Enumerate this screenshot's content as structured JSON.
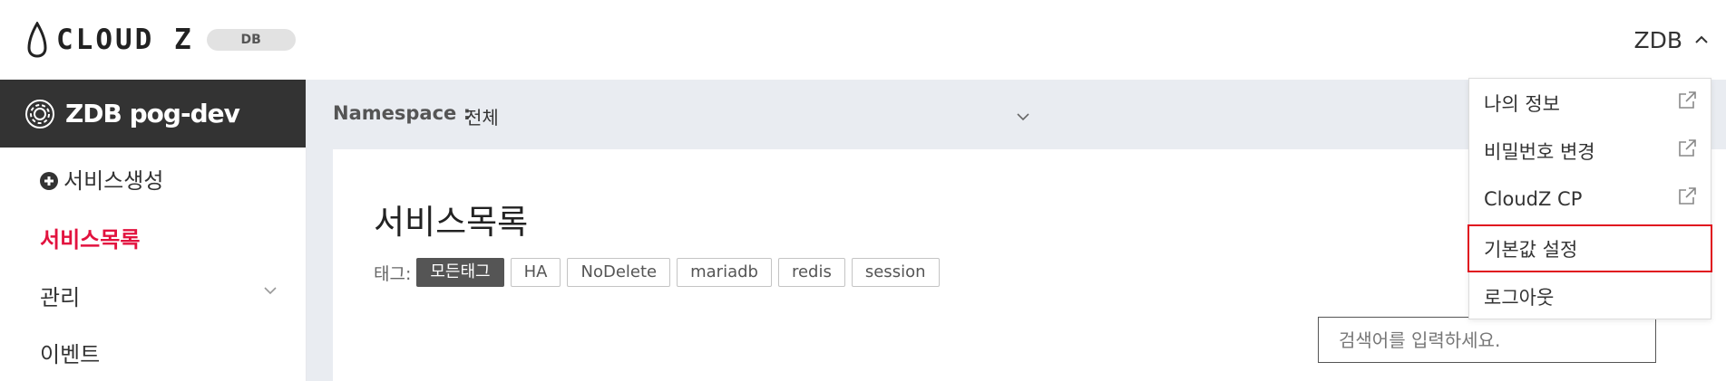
{
  "header": {
    "logo_text": "CLOUD Z",
    "badge": "DB",
    "user_name": "ZDB"
  },
  "sidebar": {
    "cluster_name": "ZDB pog-dev",
    "items": [
      {
        "label": "서비스생성"
      },
      {
        "label": "서비스목록"
      },
      {
        "label": "관리"
      },
      {
        "label": "이벤트"
      }
    ]
  },
  "filter": {
    "namespace_label": "Namespace :",
    "namespace_value": "전체"
  },
  "main": {
    "title": "서비스목록",
    "tags_label": "태그:",
    "tags": [
      "모든태그",
      "HA",
      "NoDelete",
      "mariadb",
      "redis",
      "session"
    ],
    "selected_tag": "모든태그",
    "search_placeholder": "검색어를 입력하세요."
  },
  "user_dropdown": {
    "items": [
      {
        "label": "나의 정보",
        "icon": "external-link-icon"
      },
      {
        "label": "비밀번호 변경",
        "icon": "external-link-icon"
      },
      {
        "label": "CloudZ CP",
        "icon": "external-link-icon"
      },
      {
        "label": "기본값 설정"
      },
      {
        "label": "로그아웃"
      }
    ],
    "highlighted": "기본값 설정"
  },
  "colors": {
    "sidebar_header_bg": "#333333",
    "active_nav": "#e2123e",
    "highlight_border": "#e0101e",
    "main_bg": "#e9ecf1"
  }
}
